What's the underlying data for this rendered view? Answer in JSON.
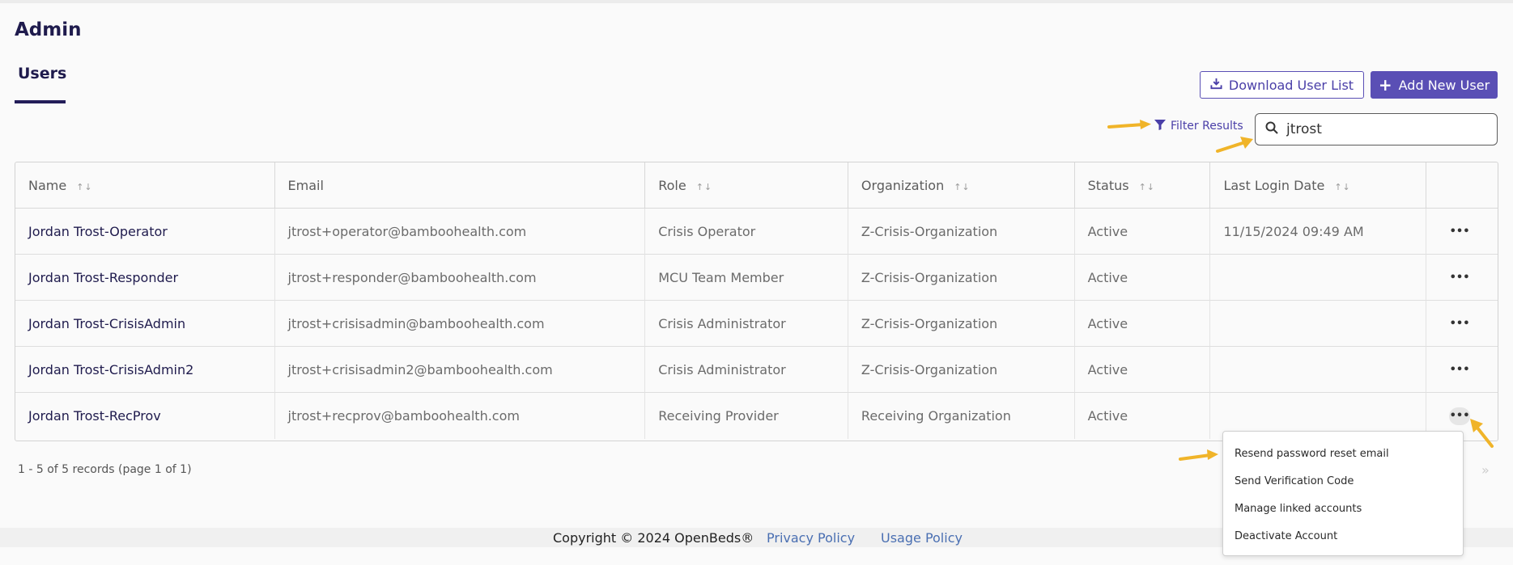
{
  "page": {
    "title": "Admin",
    "tab": "Users"
  },
  "toolbar": {
    "download_label": "Download User List",
    "add_label": "Add New User",
    "filter_label": "Filter Results",
    "search_value": "jtrost"
  },
  "table": {
    "headers": [
      "Name",
      "Email",
      "Role",
      "Organization",
      "Status",
      "Last Login Date"
    ],
    "rows": [
      {
        "name": "Jordan Trost-Operator",
        "email": "jtrost+operator@bamboohealth.com",
        "role": "Crisis Operator",
        "org": "Z-Crisis-Organization",
        "status": "Active",
        "last_login": "11/15/2024 09:49 AM"
      },
      {
        "name": "Jordan Trost-Responder",
        "email": "jtrost+responder@bamboohealth.com",
        "role": "MCU Team Member",
        "org": "Z-Crisis-Organization",
        "status": "Active",
        "last_login": ""
      },
      {
        "name": "Jordan Trost-CrisisAdmin",
        "email": "jtrost+crisisadmin@bamboohealth.com",
        "role": "Crisis Administrator",
        "org": "Z-Crisis-Organization",
        "status": "Active",
        "last_login": ""
      },
      {
        "name": "Jordan Trost-CrisisAdmin2",
        "email": "jtrost+crisisadmin2@bamboohealth.com",
        "role": "Crisis Administrator",
        "org": "Z-Crisis-Organization",
        "status": "Active",
        "last_login": ""
      },
      {
        "name": "Jordan Trost-RecProv",
        "email": "jtrost+recprov@bamboohealth.com",
        "role": "Receiving Provider",
        "org": "Receiving Organization",
        "status": "Active",
        "last_login": ""
      }
    ],
    "more_label": "•••"
  },
  "pagination": {
    "summary": "1 - 5 of 5 records (page 1 of 1)",
    "next_glyph": "»"
  },
  "dropdown": {
    "items": [
      "Resend password reset email",
      "Send Verification Code",
      "Manage linked accounts",
      "Deactivate Account"
    ]
  },
  "footer": {
    "copyright": "Copyright © 2024 OpenBeds®",
    "privacy": "Privacy Policy",
    "usage": "Usage Policy"
  },
  "icons": {
    "download": "download-icon",
    "plus": "plus-icon",
    "filter": "filter-icon",
    "search": "search-icon",
    "sort": "sort-icon",
    "more": "more-horizontal-icon",
    "arrow": "annotation-arrow-icon"
  },
  "colors": {
    "accent": "#5a4fb5",
    "title": "#1f1b4d",
    "link": "#4a6fb2",
    "annotation": "#f0b429"
  }
}
